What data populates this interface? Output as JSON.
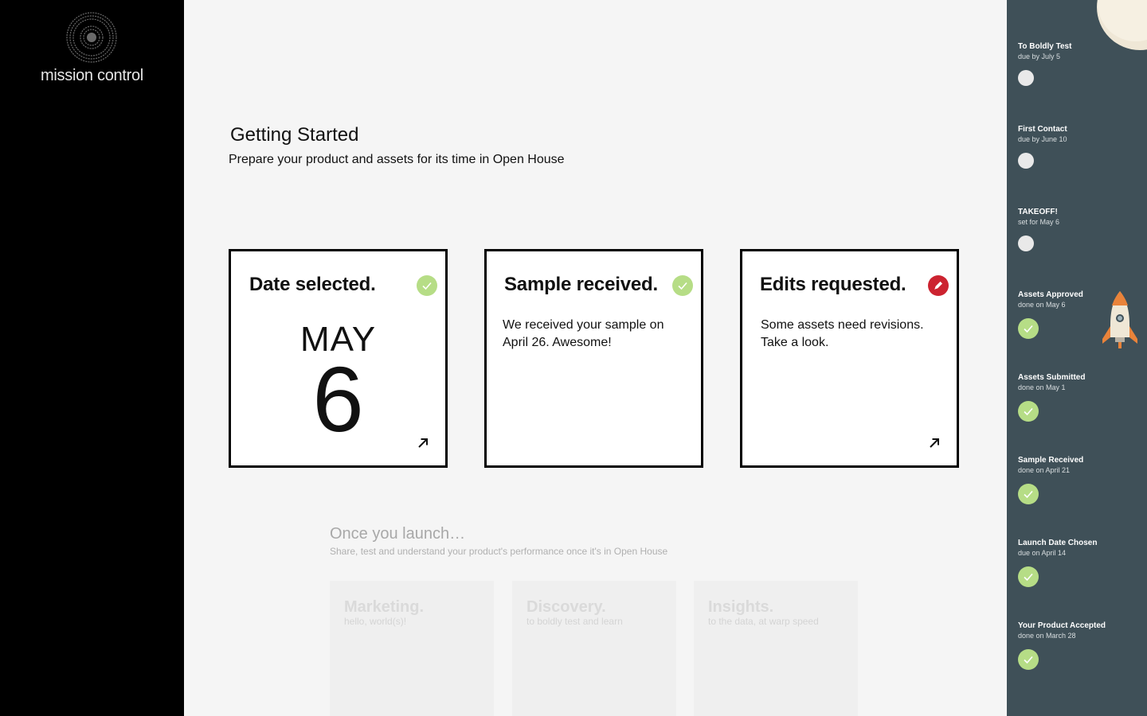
{
  "app": {
    "logo_text": "mission control"
  },
  "header": {
    "title": "Getting Started",
    "subtitle": "Prepare your product and assets for its time in Open House"
  },
  "cards": [
    {
      "title": "Date selected.",
      "status": "done",
      "month": "MAY",
      "day": "6",
      "icon": "check-icon",
      "link_icon": "arrow-up-right-icon"
    },
    {
      "title": "Sample received.",
      "status": "done",
      "text": "We received your sample on April 26. Awesome!",
      "icon": "check-icon"
    },
    {
      "title": "Edits requested.",
      "status": "edit",
      "text": "Some assets need revisions. Take a look.",
      "icon": "pencil-icon",
      "link_icon": "arrow-up-right-icon"
    }
  ],
  "launch": {
    "title": "Once you launch…",
    "subtitle": "Share, test and understand your product's performance once it's in Open House",
    "cards": [
      {
        "title": "Marketing.",
        "subtitle": "hello, world(s)!"
      },
      {
        "title": "Discovery.",
        "subtitle": "to boldly test and learn"
      },
      {
        "title": "Insights.",
        "subtitle": "to the data, at warp speed"
      }
    ]
  },
  "timeline": [
    {
      "title": "To Boldly Test",
      "sub": "due by July 5",
      "state": "pending"
    },
    {
      "title": "First Contact",
      "sub": "due by June 10",
      "state": "pending"
    },
    {
      "title": "TAKEOFF!",
      "sub": "set for May 6",
      "state": "pending"
    },
    {
      "title": "Assets Approved",
      "sub": "done on May 6",
      "state": "done"
    },
    {
      "title": "Assets Submitted",
      "sub": "done on May 1",
      "state": "done"
    },
    {
      "title": "Sample Received",
      "sub": "done on April 21",
      "state": "done"
    },
    {
      "title": "Launch Date Chosen",
      "sub": "due on April 14",
      "state": "done"
    },
    {
      "title": "Your Product Accepted",
      "sub": "done on March 28",
      "state": "done"
    }
  ],
  "colors": {
    "sidebar_left": "#000000",
    "sidebar_right": "#3f5058",
    "done_green": "#b6dd86",
    "edit_red": "#cc2330",
    "pending_dot": "#e9e9e9"
  }
}
